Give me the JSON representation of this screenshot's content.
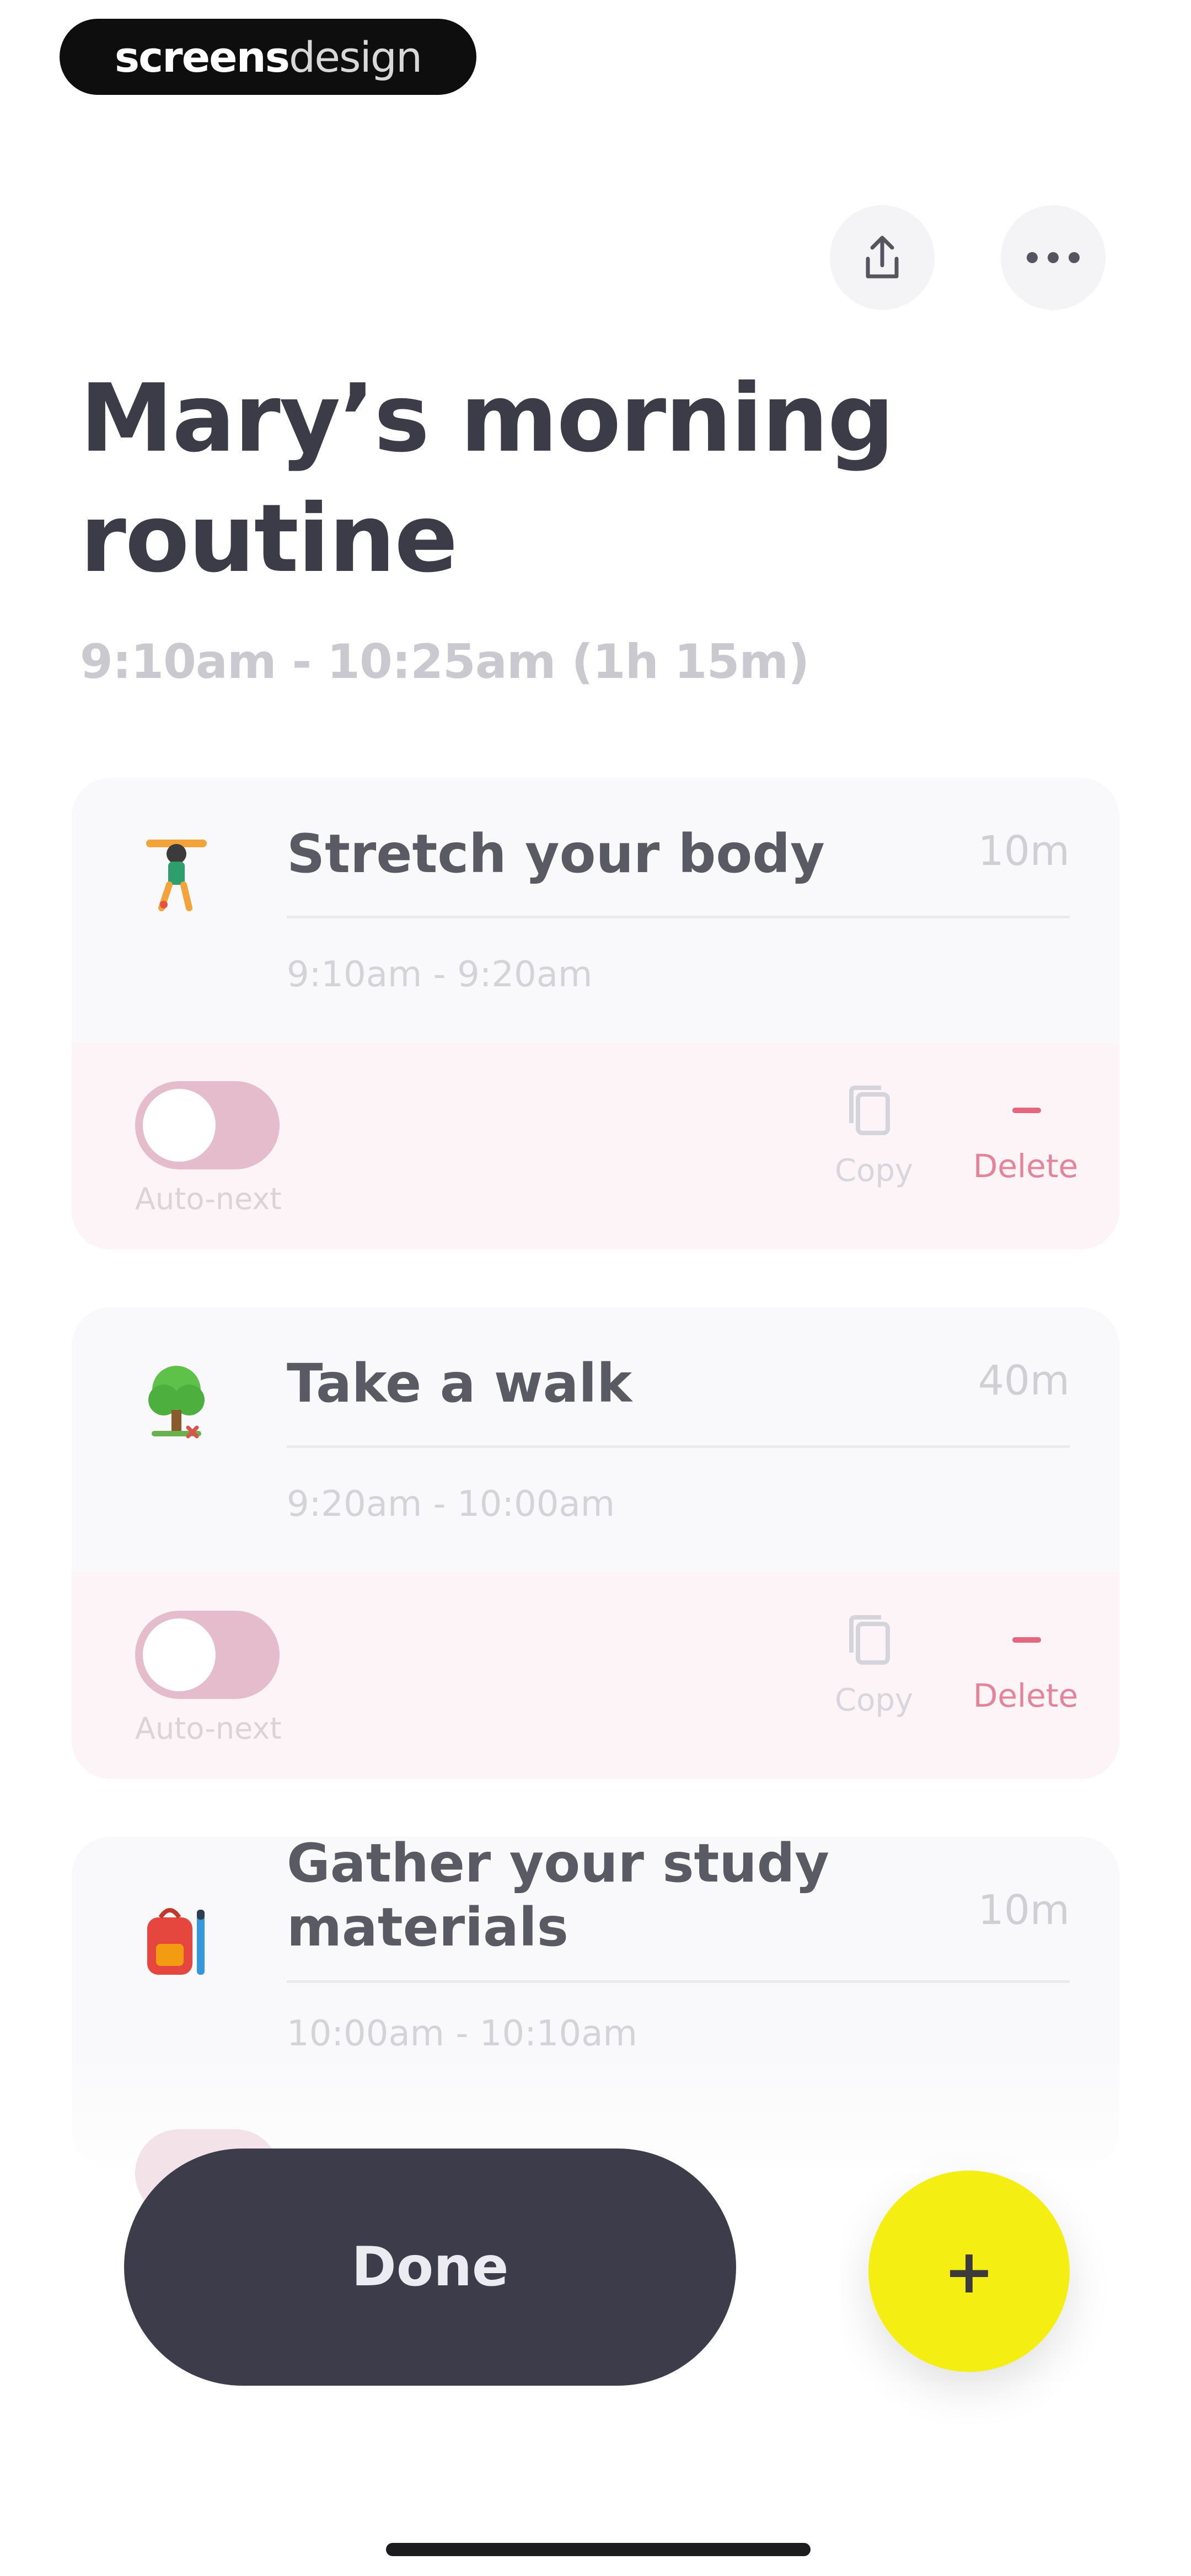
{
  "watermark": {
    "bold": "screens",
    "light": "design"
  },
  "header": {
    "share_icon": "share-icon",
    "more_icon": "more-horizontal-icon",
    "title": "Mary’s morning routine",
    "time_range": "9:10am - 10:25am (1h 15m)"
  },
  "tasks": [
    {
      "icon": "person-stretching-emoji",
      "name": "Stretch your body",
      "duration": "10m",
      "time": "9:10am - 9:20am",
      "auto_next_label": "Auto-next",
      "copy_label": "Copy",
      "delete_label": "Delete"
    },
    {
      "icon": "tree-emoji",
      "name": "Take a walk",
      "duration": "40m",
      "time": "9:20am - 10:00am",
      "auto_next_label": "Auto-next",
      "copy_label": "Copy",
      "delete_label": "Delete"
    },
    {
      "icon": "backpack-emoji",
      "name": "Gather your study materials",
      "duration": "10m",
      "time": "10:00am - 10:10am"
    }
  ],
  "actions": {
    "done_label": "Done",
    "add_label": "+"
  },
  "colors": {
    "accent_yellow": "#f4ee13",
    "dark_button": "#3d3c4a",
    "delete_red": "#e4677f",
    "toggle_off": "#e4bccb"
  }
}
